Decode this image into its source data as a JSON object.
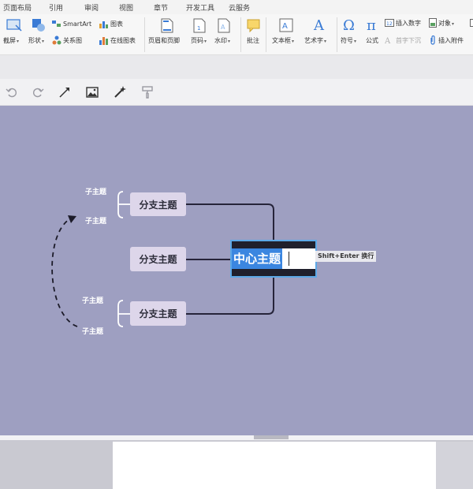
{
  "menu_tabs": [
    "页面布局",
    "引用",
    "审阅",
    "视图",
    "章节",
    "开发工具",
    "云服务"
  ],
  "ribbon": {
    "screenshot": "截屏",
    "shape": "形状",
    "smartart": "SmartArt",
    "chart": "图表",
    "relation_chart": "关系图",
    "online_chart": "在线图表",
    "header_footer": "页眉和页脚",
    "page_number": "页码",
    "watermark": "水印",
    "comment": "批注",
    "textbox": "文本框",
    "wordart": "艺术字",
    "symbol": "符号",
    "formula": "公式",
    "insert_number": "插入数字",
    "object": "对象",
    "drop_cap": "首字下沉",
    "insert_attachment": "插入附件"
  },
  "mindmap": {
    "central_topic": "中心主题",
    "hint": "Shift+Enter 换行",
    "branches": [
      "分支主题",
      "分支主题",
      "分支主题"
    ],
    "subtopic": "子主题"
  },
  "colors": {
    "canvas": "#9e9fc1",
    "node_fill": "#ddd6ea",
    "central_fill": "#20202c",
    "selection": "#3b86e0",
    "connector": "#26243a"
  }
}
